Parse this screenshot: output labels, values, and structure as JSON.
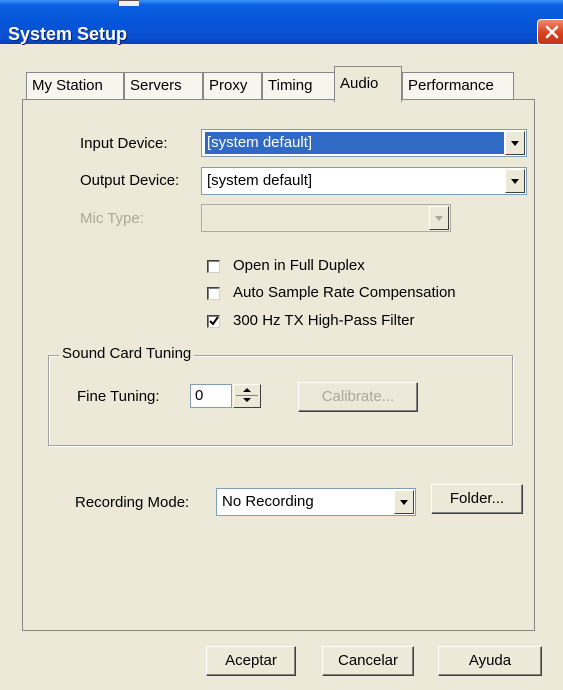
{
  "window": {
    "title": "System Setup"
  },
  "tabs": [
    {
      "label": "My Station"
    },
    {
      "label": "Servers"
    },
    {
      "label": "Proxy"
    },
    {
      "label": "Timing"
    },
    {
      "label": "Audio",
      "active": true
    },
    {
      "label": "Performance"
    }
  ],
  "audio": {
    "input_device_label": "Input Device:",
    "input_device_value": "[system default]",
    "output_device_label": "Output Device:",
    "output_device_value": "[system default]",
    "mic_type_label": "Mic Type:",
    "mic_type_value": "",
    "full_duplex_label": "Open in Full Duplex",
    "full_duplex_checked": false,
    "auto_sample_label": "Auto Sample Rate Compensation",
    "auto_sample_checked": false,
    "highpass_label": "300 Hz TX High-Pass Filter",
    "highpass_checked": true
  },
  "sound_card": {
    "group_label": "Sound Card Tuning",
    "fine_tuning_label": "Fine Tuning:",
    "fine_tuning_value": "0",
    "calibrate_label": "Calibrate..."
  },
  "recording": {
    "mode_label": "Recording Mode:",
    "mode_value": "No Recording",
    "folder_label": "Folder..."
  },
  "footer": {
    "ok_label": "Aceptar",
    "cancel_label": "Cancelar",
    "help_label": "Ayuda"
  },
  "colors": {
    "titlebar": "#0a5fe0",
    "dialog_bg": "#ece9d8",
    "selection": "#316ac5",
    "close_button": "#d8401e"
  }
}
